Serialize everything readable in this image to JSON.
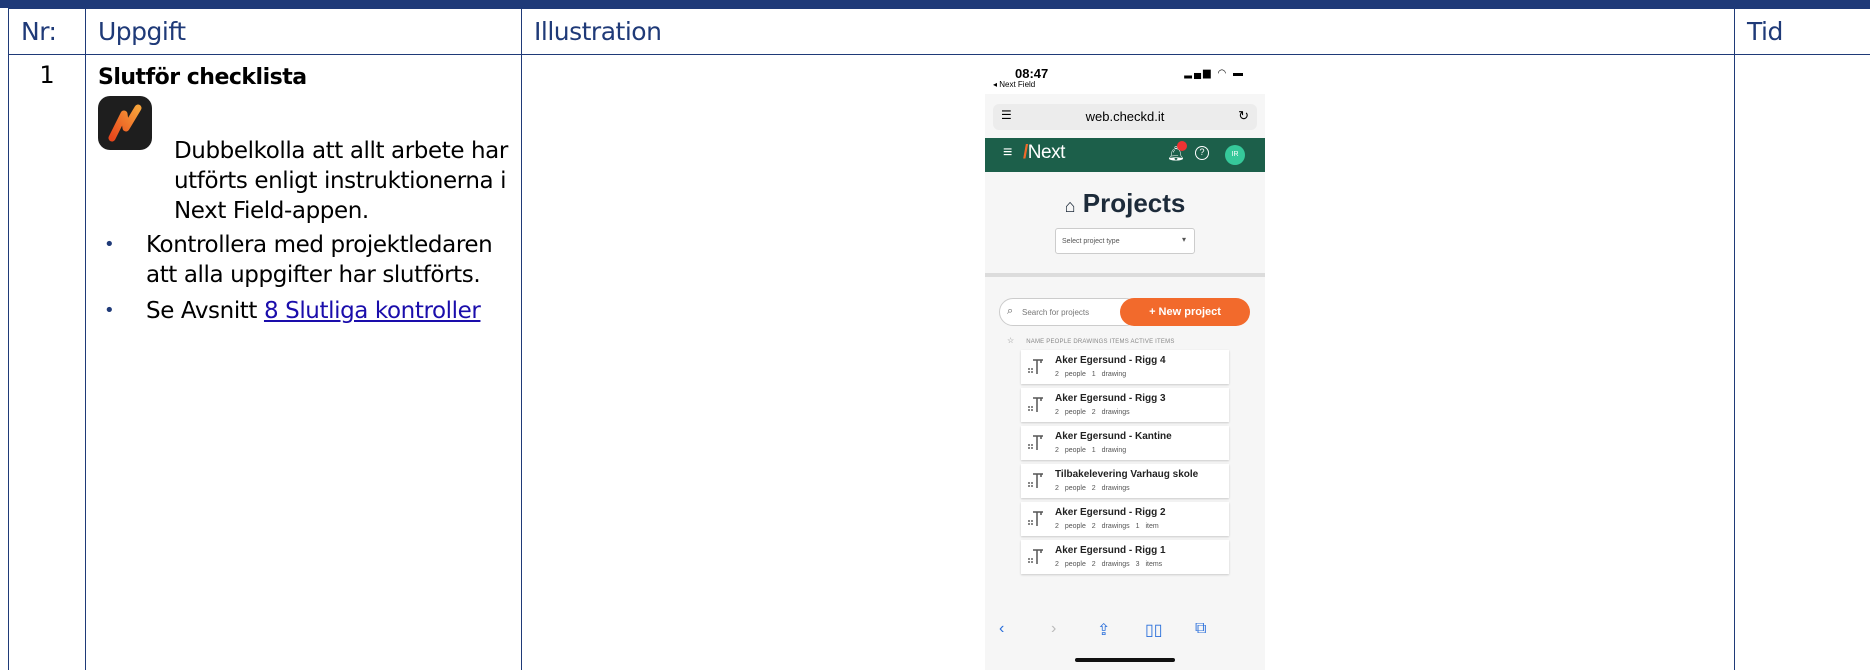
{
  "table": {
    "headers": [
      "Nr:",
      "Uppgift",
      "Illustration",
      "Tid"
    ],
    "row": {
      "nr": "1",
      "task_title": "Slutför checklista",
      "app_description": "Dubbelkolla att allt arbete har utförts enligt instruktionerna i Next Field-appen.",
      "bullets": [
        "Kontrollera med projektledaren att alla uppgifter har slutförts.",
        "Se Avsnitt "
      ],
      "link_text": "8 Slutliga kontroller",
      "tid": ""
    }
  },
  "phone": {
    "time": "08:47",
    "back_label": "◂ Next Field",
    "url": "web.checkd.it",
    "logo": "Next",
    "title": "Projects",
    "select_placeholder": "Select project type",
    "search_placeholder": "Search for projects",
    "new_project": "+ New project",
    "columns": "NAME  PEOPLE  DRAWINGS  ITEMS  ACTIVE ITEMS",
    "projects": [
      {
        "name": "Aker Egersund - Rigg 4",
        "meta": "2 people  1 drawing"
      },
      {
        "name": "Aker Egersund - Rigg 3",
        "meta": "2 people  2 drawings"
      },
      {
        "name": "Aker Egersund - Kantine",
        "meta": "2 people  1 drawing"
      },
      {
        "name": "Tilbakelevering Varhaug skole",
        "meta": "2 people  2 drawings"
      },
      {
        "name": "Aker Egersund - Rigg 2",
        "meta": "2 people  2 drawings  1 item"
      },
      {
        "name": "Aker Egersund - Rigg 1",
        "meta": "2 people  2 drawings  3 items"
      }
    ]
  },
  "colors": {
    "header_border": "#1f3a78",
    "nav_green": "#1c5f4a",
    "accent_orange": "#f26a2c",
    "link": "#1a0dab"
  }
}
